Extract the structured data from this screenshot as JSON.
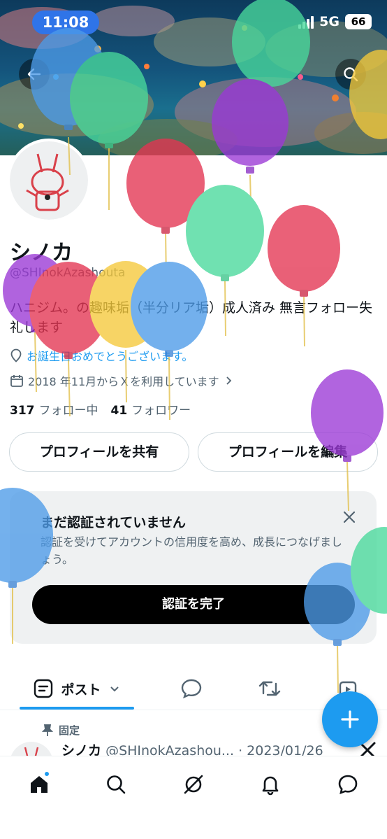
{
  "status_bar": {
    "time": "11:08",
    "network": "5G",
    "battery": "66"
  },
  "profile": {
    "name": "シノカ",
    "handle": "@SHInokAzashouta",
    "bio": "ハニジム。の趣味垢（半分リア垢）成人済み 無言フォロー失礼します",
    "birthday": "お誕生日おめでとうございます。",
    "joined": "2018 年11月からＸを利用しています",
    "following_count": "317",
    "following_label": "フォロー中",
    "followers_count": "41",
    "followers_label": "フォロワー"
  },
  "actions": {
    "share": "プロフィールを共有",
    "edit": "プロフィールを編集"
  },
  "verify": {
    "title": "まだ認証されていません",
    "description": "認証を受けてアカウントの信用度を高め、成長につなげましょう。",
    "button": "認証を完了"
  },
  "tabs": {
    "posts": "ポスト"
  },
  "pinned_post": {
    "pinned_label": "固定",
    "author": "シノカ",
    "meta": "@SHInokAzashou... · 2023/01/26"
  },
  "colors": {
    "accent": "#1d9bf0",
    "text": "#0f1419",
    "muted": "#536471"
  },
  "icons": [
    "back-arrow-icon",
    "search-icon",
    "location-pin-icon",
    "calendar-icon",
    "chevron-right-icon",
    "close-icon",
    "posts-icon",
    "chevron-down-icon",
    "reply-icon",
    "repost-icon",
    "media-icon",
    "pin-icon",
    "x-logo-icon",
    "plus-icon",
    "home-icon",
    "explore-icon",
    "grok-icon",
    "notifications-icon",
    "messages-icon"
  ]
}
